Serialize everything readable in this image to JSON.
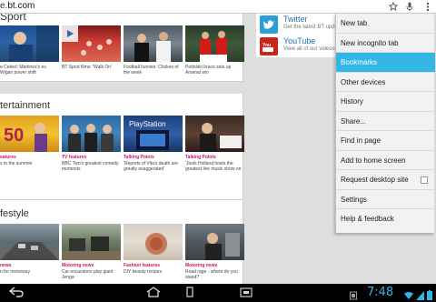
{
  "browser": {
    "url_prefix": "e.",
    "url_host": "bt.com"
  },
  "sections": [
    {
      "title": "Sport",
      "cards": [
        {
          "caption": "e Cekeri: Martinez's es Wigan power shift"
        },
        {
          "caption": "BT Sport films: 'Walk On'"
        },
        {
          "caption": "Football funnies: Chokes of the week"
        },
        {
          "caption": "Podolski brace sets up Arsenal win"
        }
      ]
    },
    {
      "title": "tertainment",
      "cards": [
        {
          "head": "eatures",
          "caption": "s to the summer"
        },
        {
          "head": "TV features",
          "caption": "BBC Two's greatest comedy moments"
        },
        {
          "head": "Talking Points",
          "caption": "'Reports of Vita's death are greatly exaggerated'"
        },
        {
          "head": "Talking Points",
          "caption": "'Jools Holland hosts the greatest live music show on TV'"
        }
      ]
    },
    {
      "title": "festyle",
      "cards": [
        {
          "head": "news",
          "caption": "n for motorway"
        },
        {
          "head": "Motoring news",
          "caption": "Car excavators play giant Jenga"
        },
        {
          "head": "Fashion features",
          "caption": "DIY beauty recipes"
        },
        {
          "head": "Motoring news",
          "caption": "Road rage - where do you stand?"
        }
      ]
    }
  ],
  "social": [
    {
      "name": "Twitter",
      "desc": "Get the latest BT updat",
      "icon": "twitter-icon",
      "color": "#2a9fd8"
    },
    {
      "name": "YouTube",
      "desc": "View all of our videos",
      "icon": "youtube-icon",
      "color": "#c8261b"
    }
  ],
  "menu": {
    "items": [
      {
        "label": "New tab"
      },
      {
        "label": "New incognito tab"
      },
      {
        "label": "Bookmarks",
        "selected": true
      },
      {
        "label": "Other devices"
      },
      {
        "label": "History"
      },
      {
        "label": "Share..."
      },
      {
        "label": "Find in page"
      },
      {
        "label": "Add to home screen"
      },
      {
        "label": "Request desktop site",
        "checkbox": true,
        "checked": false
      },
      {
        "label": "Settings"
      },
      {
        "label": "Help & feedback"
      }
    ]
  },
  "system": {
    "clock": "7:48",
    "accent": "#33b5e5"
  }
}
